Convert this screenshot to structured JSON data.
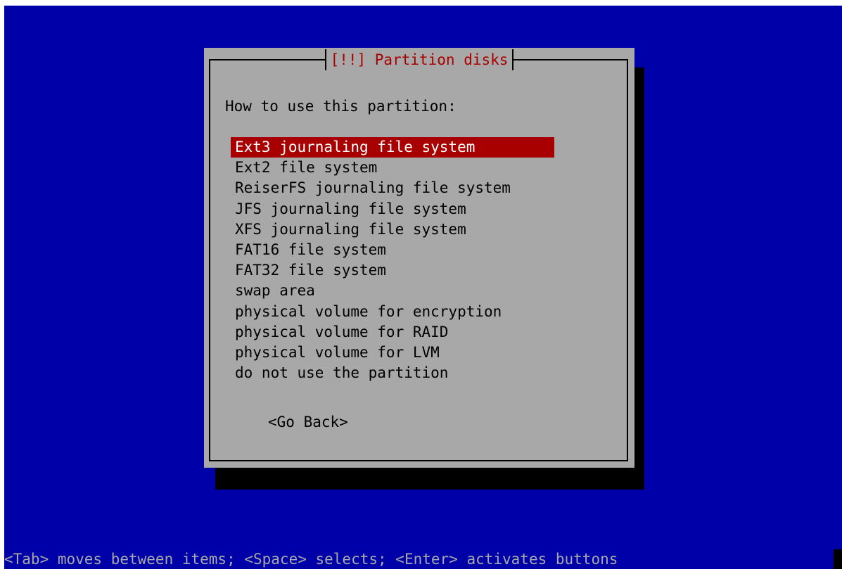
{
  "dialog": {
    "title": "[!!] Partition disks",
    "prompt": "How to use this partition:",
    "options": [
      "Ext3 journaling file system",
      "Ext2 file system",
      "ReiserFS journaling file system",
      "JFS journaling file system",
      "XFS journaling file system",
      "FAT16 file system",
      "FAT32 file system",
      "swap area",
      "physical volume for encryption",
      "physical volume for RAID",
      "physical volume for LVM",
      "do not use the partition"
    ],
    "selected_option": "Ext3 journaling file system",
    "go_back_label": "<Go Back>"
  },
  "status_bar": {
    "help_text": "<Tab> moves between items; <Space> selects; <Enter> activates buttons"
  },
  "colors": {
    "background": "#0000a8",
    "dialog": "#a8a8a8",
    "highlight": "#a80000",
    "title": "#a80000",
    "shadow": "#000000"
  }
}
